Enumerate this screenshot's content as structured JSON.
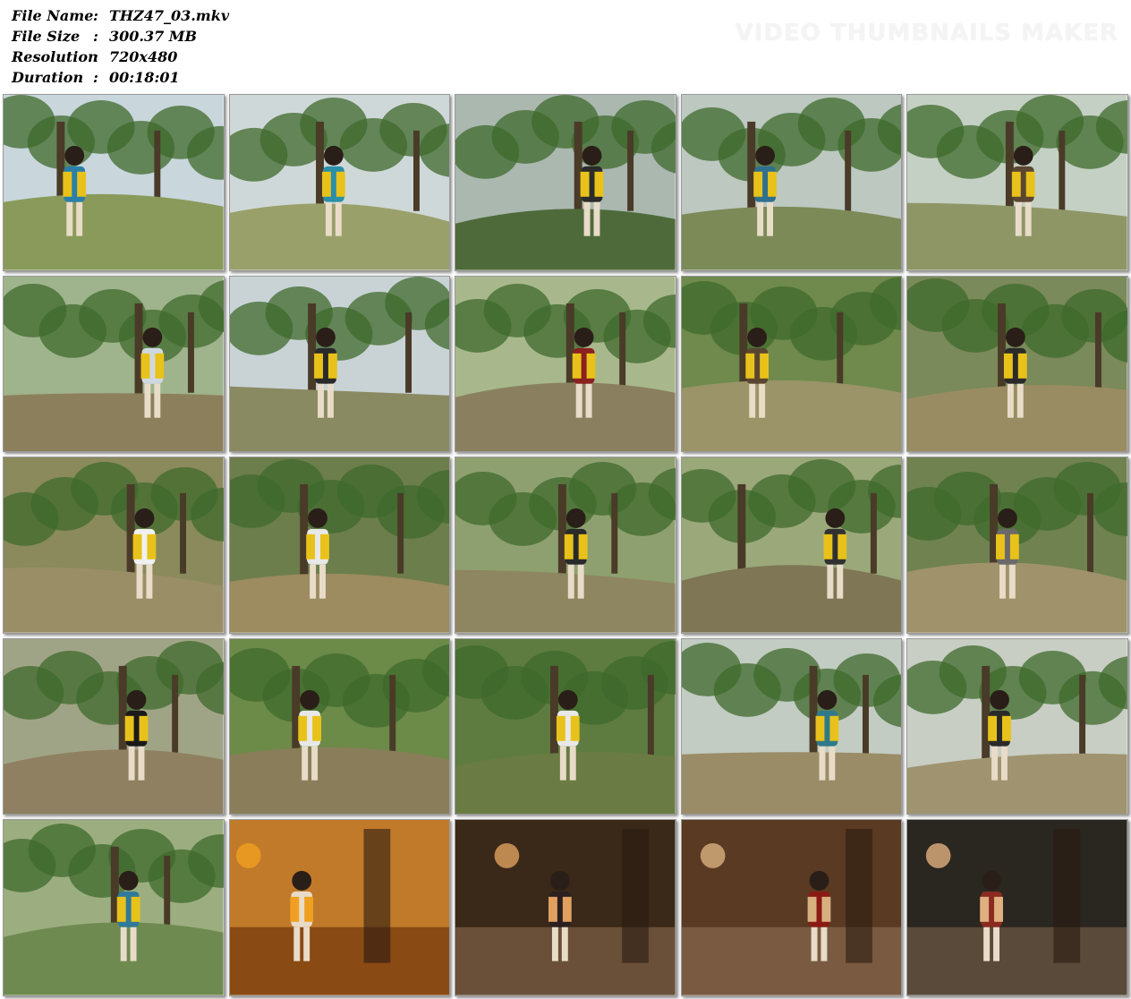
{
  "file_info": {
    "file_name_label": "File Name",
    "file_name": "THZ47_03.mkv",
    "file_size_label": "File Size",
    "file_size": "300.37 MB",
    "resolution_label": "Resolution",
    "resolution": "720x480",
    "duration_label": "Duration",
    "duration": "00:18:01",
    "separator": ":"
  },
  "watermark": "VIDEO THUMBNAILS MAKER",
  "thumbnails": [
    {
      "scene": "park",
      "sky": "#c9d6dc",
      "ground": "#8a9a5a",
      "accent": "#e8c21a",
      "figure": "#2a7fa8"
    },
    {
      "scene": "park",
      "sky": "#cfd8d8",
      "ground": "#9aa06a",
      "accent": "#e8c21a",
      "figure": "#2b8fa8"
    },
    {
      "scene": "park",
      "sky": "#aab8b0",
      "ground": "#4f6a3a",
      "accent": "#e8c21a",
      "figure": "#2b2b2b"
    },
    {
      "scene": "park",
      "sky": "#bcc8c0",
      "ground": "#7c8a58",
      "accent": "#e8c21a",
      "figure": "#2f6f8f"
    },
    {
      "scene": "park",
      "sky": "#c4d0c4",
      "ground": "#8f9666",
      "accent": "#e8c21a",
      "figure": "#5a4632"
    },
    {
      "scene": "field",
      "sky": "#9fb38c",
      "ground": "#8c7f5c",
      "accent": "#e8c21a",
      "figure": "#cfd8e0"
    },
    {
      "scene": "park",
      "sky": "#c9d3d6",
      "ground": "#8a8a62",
      "accent": "#e8c21a",
      "figure": "#2a2a2a"
    },
    {
      "scene": "field",
      "sky": "#a8b88c",
      "ground": "#8a8060",
      "accent": "#e8c21a",
      "figure": "#8a2020"
    },
    {
      "scene": "field",
      "sky": "#6f8a4c",
      "ground": "#9a9468",
      "accent": "#e8c21a",
      "figure": "#5a4630"
    },
    {
      "scene": "field",
      "sky": "#7a8a5a",
      "ground": "#9a8c62",
      "accent": "#e8c21a",
      "figure": "#2a2a2a"
    },
    {
      "scene": "field",
      "sky": "#8a8a5c",
      "ground": "#9a8e66",
      "accent": "#e8c21a",
      "figure": "#f0f0f0"
    },
    {
      "scene": "field",
      "sky": "#6c7e4c",
      "ground": "#9c8c60",
      "accent": "#e8c21a",
      "figure": "#e8e8e8"
    },
    {
      "scene": "park",
      "sky": "#8ea070",
      "ground": "#8e8660",
      "accent": "#e8c21a",
      "figure": "#2a2a2a"
    },
    {
      "scene": "park",
      "sky": "#9aa87a",
      "ground": "#7e7654",
      "accent": "#e8c21a",
      "figure": "#303030"
    },
    {
      "scene": "field",
      "sky": "#6f8250",
      "ground": "#a0926a",
      "accent": "#e8c21a",
      "figure": "#6a6a6a"
    },
    {
      "scene": "field",
      "sky": "#a0a486",
      "ground": "#8e8060",
      "accent": "#e8c21a",
      "figure": "#1a1a1a"
    },
    {
      "scene": "field",
      "sky": "#6c8a48",
      "ground": "#8a7e5a",
      "accent": "#e8c21a",
      "figure": "#e8e8e8"
    },
    {
      "scene": "park",
      "sky": "#5e7c40",
      "ground": "#6a7c44",
      "accent": "#e8c21a",
      "figure": "#e8e8e8"
    },
    {
      "scene": "park",
      "sky": "#c2ccc2",
      "ground": "#9a8c66",
      "accent": "#e8c21a",
      "figure": "#2f7a8a"
    },
    {
      "scene": "park",
      "sky": "#c8cec4",
      "ground": "#a09470",
      "accent": "#e8c21a",
      "figure": "#2a2a2a"
    },
    {
      "scene": "park",
      "sky": "#9cae80",
      "ground": "#6f8a50",
      "accent": "#e8c21a",
      "figure": "#2f7a9a"
    },
    {
      "scene": "studio",
      "sky": "#c07a2a",
      "ground": "#8a4a14",
      "accent": "#f0a020",
      "figure": "#e8dcc8"
    },
    {
      "scene": "studio",
      "sky": "#3a2818",
      "ground": "#6a5038",
      "accent": "#e0a060",
      "figure": "#2a2020"
    },
    {
      "scene": "studio",
      "sky": "#5a3a22",
      "ground": "#7a5a40",
      "accent": "#d8b080",
      "figure": "#8a1a14"
    },
    {
      "scene": "studio",
      "sky": "#2a2620",
      "ground": "#5a4a3a",
      "accent": "#e0b080",
      "figure": "#8a2a20"
    }
  ]
}
